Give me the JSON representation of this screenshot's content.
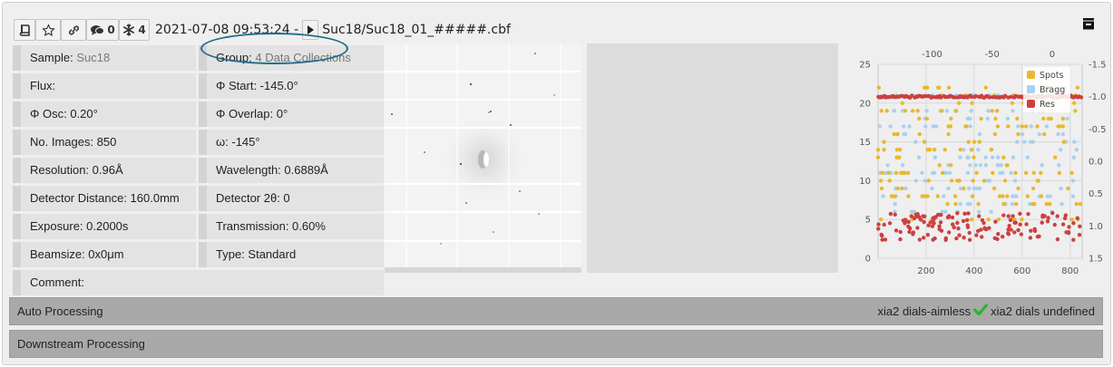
{
  "header": {
    "comment_count": "0",
    "snowflake_count": "4",
    "datetime": "2021-07-08 09:53:24 -",
    "file_path": "Suc18/Suc18_01_#####.cbf"
  },
  "info": {
    "sample_label": "Sample:",
    "sample_value": "Suc18",
    "group_label": "Group:",
    "group_value": "4 Data Collections",
    "flux": "Flux:",
    "phi_start": "Φ Start: -145.0°",
    "phi_osc": "Φ Osc: 0.20°",
    "phi_overlap": "Φ Overlap: 0°",
    "no_images": "No. Images: 850",
    "omega": "ω: -145°",
    "resolution": "Resolution: 0.96Å",
    "wavelength": "Wavelength: 0.6889Å",
    "detector_distance": "Detector Distance: 160.0mm",
    "detector_2theta": "Detector 2θ: 0",
    "exposure": "Exposure: 0.2000s",
    "transmission": "Transmission: 0.60%",
    "beamsize": "Beamsize: 0x0μm",
    "type": "Type: Standard",
    "comment": "Comment:"
  },
  "processing": {
    "auto_label": "Auto Processing",
    "downstream_label": "Downstream Processing",
    "xia2_aimless": "xia2 dials-aimless",
    "xia2_undefined": "xia2 dials undefined"
  },
  "colors": {
    "spots": "#e8b92e",
    "bragg": "#a9d1ef",
    "res": "#cc4040",
    "ring": "#1f6d8c",
    "check": "#2bb52b"
  },
  "icons": [
    "book-icon",
    "star-icon",
    "link-icon",
    "comments-icon",
    "snowflake-icon",
    "play-icon",
    "tray-icon",
    "check-icon"
  ],
  "chart_data": {
    "type": "scatter",
    "legend": [
      "Spots",
      "Bragg",
      "Res"
    ],
    "legend_position": "top-right",
    "x_bottom": {
      "lim": [
        0,
        850
      ],
      "ticks": [
        "200",
        "400",
        "600",
        "800"
      ]
    },
    "x_top": {
      "lim": [
        -145,
        25
      ],
      "ticks": [
        "-100",
        "-50",
        "0"
      ]
    },
    "y_left": {
      "lim": [
        0,
        25
      ],
      "ticks": [
        "0",
        "5",
        "10",
        "15",
        "20",
        "25"
      ]
    },
    "y_right": {
      "lim": [
        1.5,
        -1.5
      ],
      "ticks": [
        "1.5",
        "1.0",
        "0.5",
        "0.0",
        "-0.5",
        "-1.0",
        "-1.5"
      ]
    },
    "grid": true,
    "series": [
      {
        "name": "Spots",
        "axis": "left",
        "approx_range": [
          5,
          22
        ],
        "n": 170
      },
      {
        "name": "Bragg",
        "axis": "left",
        "approx_range": [
          6,
          21
        ],
        "n": 150
      },
      {
        "name": "Res",
        "axis": "right",
        "approx_values": {
          "upper_band": -1.0,
          "lower_band_range": [
            0.8,
            1.2
          ]
        },
        "n": 280
      }
    ]
  }
}
